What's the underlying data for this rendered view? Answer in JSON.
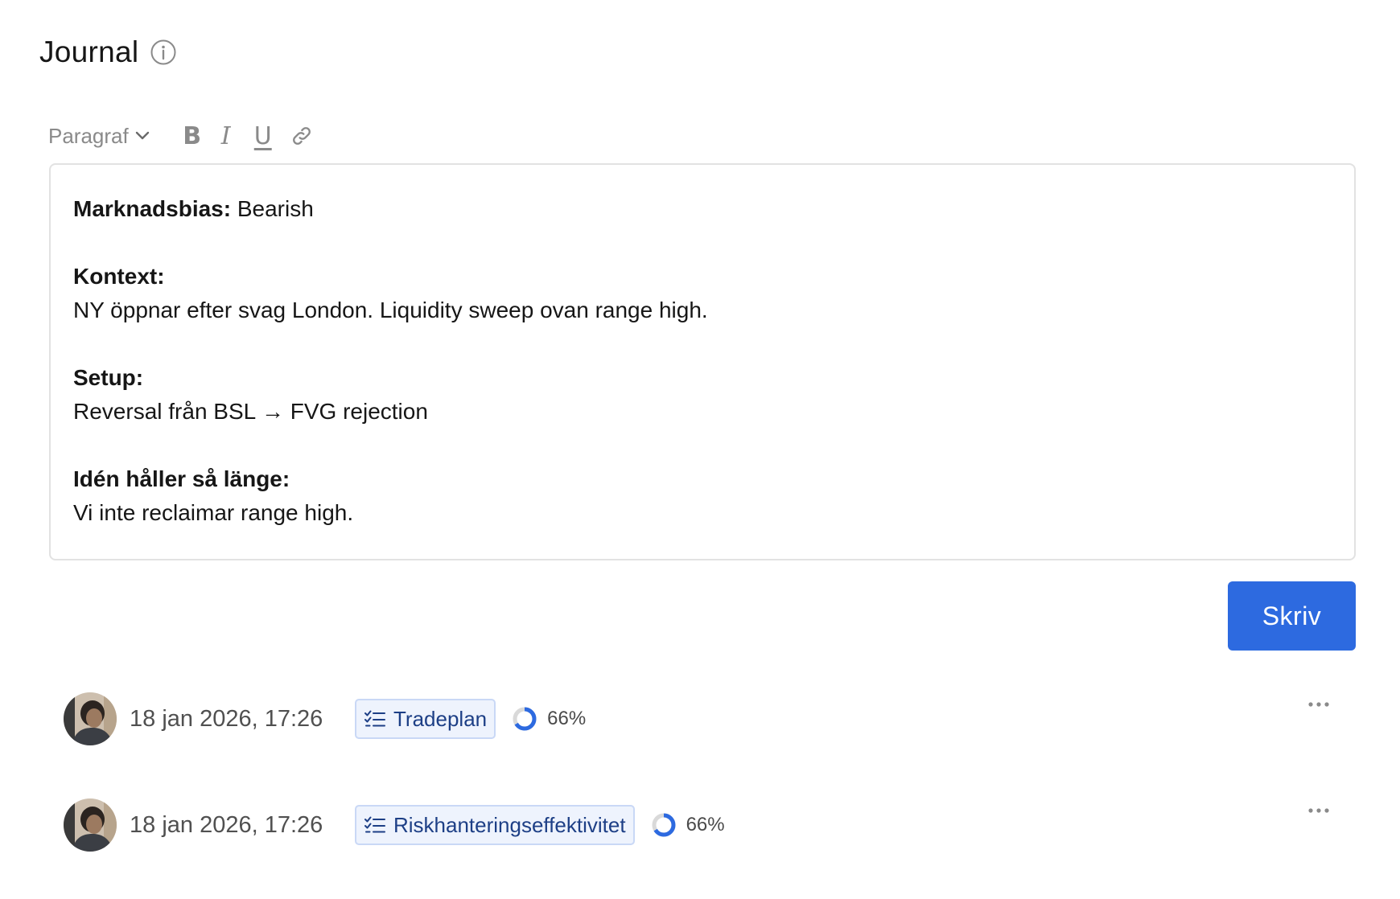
{
  "header": {
    "title": "Journal",
    "info_icon": "info-icon"
  },
  "toolbar": {
    "block_type": "Paragraf",
    "bold_label": "B",
    "italic_label": "I",
    "underline_label": "U",
    "link_icon": "link-icon",
    "dropdown_icon": "chevron-down-icon"
  },
  "editor": {
    "bias_label": "Marknadsbias:",
    "bias_value": " Bearish",
    "context_label": "Kontext:",
    "context_text": "NY öppnar efter svag London. Liquidity sweep ovan range high.",
    "setup_label": "Setup:",
    "setup_text": "Reversal från BSL → FVG rejection",
    "holds_label": "Idén håller så länge:",
    "holds_text": "Vi inte reclaimar range high."
  },
  "submit_label": "Skriv",
  "entries": [
    {
      "date": "18 jan 2026, 17:26",
      "tag": "Tradeplan",
      "tag_icon": "checklist-icon",
      "progress": 0.66,
      "progress_label": "66%"
    },
    {
      "date": "18 jan 2026, 17:26",
      "tag": "Riskhanteringseffektivitet",
      "tag_icon": "checklist-icon",
      "progress": 0.66,
      "progress_label": "66%"
    }
  ],
  "colors": {
    "accent": "#2d6ae0",
    "tag_bg": "#eef3fd",
    "tag_border": "#c9d8f6",
    "tag_text": "#1d3f86",
    "progress_track": "#d9d9d9"
  }
}
